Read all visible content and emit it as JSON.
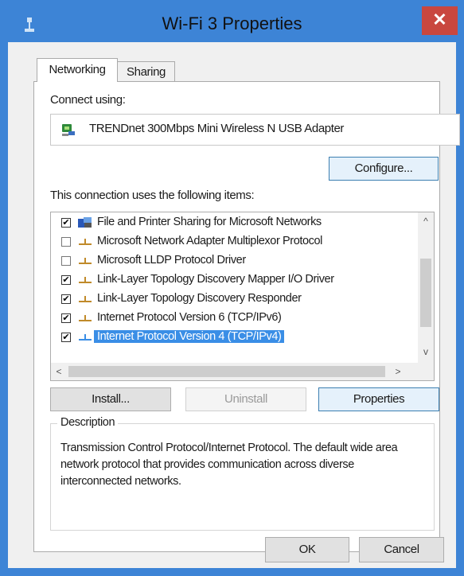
{
  "window": {
    "title": "Wi-Fi 3 Properties",
    "close_glyph": "✕"
  },
  "tabs": [
    {
      "label": "Networking"
    },
    {
      "label": "Sharing"
    }
  ],
  "connect_using_label": "Connect using:",
  "adapter": {
    "name": "TRENDnet 300Mbps Mini Wireless N USB Adapter",
    "icon": "network-adapter-icon"
  },
  "configure_label": "Configure...",
  "items_label": "This connection uses the following items:",
  "items": [
    {
      "label": "File and Printer Sharing for Microsoft Networks",
      "checked": true,
      "check_glyph": "✔",
      "icon": "file-printer-sharing-icon",
      "selected": false
    },
    {
      "label": "Microsoft Network Adapter Multiplexor Protocol",
      "checked": false,
      "check_glyph": "",
      "icon": "protocol-icon",
      "selected": false
    },
    {
      "label": "Microsoft LLDP Protocol Driver",
      "checked": false,
      "check_glyph": "",
      "icon": "protocol-icon",
      "selected": false
    },
    {
      "label": "Link-Layer Topology Discovery Mapper I/O Driver",
      "checked": true,
      "check_glyph": "✔",
      "icon": "protocol-icon",
      "selected": false
    },
    {
      "label": "Link-Layer Topology Discovery Responder",
      "checked": true,
      "check_glyph": "✔",
      "icon": "protocol-icon",
      "selected": false
    },
    {
      "label": "Internet Protocol Version 6 (TCP/IPv6)",
      "checked": true,
      "check_glyph": "✔",
      "icon": "protocol-icon",
      "selected": false
    },
    {
      "label": "Internet Protocol Version 4 (TCP/IPv4)",
      "checked": true,
      "check_glyph": "✔",
      "icon": "protocol-icon",
      "selected": true
    }
  ],
  "scroll": {
    "up": "^",
    "down": "v",
    "left": "<",
    "right": ">"
  },
  "buttons": {
    "install": "Install...",
    "uninstall": "Uninstall",
    "properties": "Properties",
    "ok": "OK",
    "cancel": "Cancel"
  },
  "description": {
    "legend": "Description",
    "text": "Transmission Control Protocol/Internet Protocol. The default wide area network protocol that provides communication across diverse interconnected networks."
  },
  "colors": {
    "title_bar": "#3d84d6",
    "close_button": "#c9473f",
    "selection": "#3a8ee6",
    "dialog_bg": "#f0f0f0"
  }
}
